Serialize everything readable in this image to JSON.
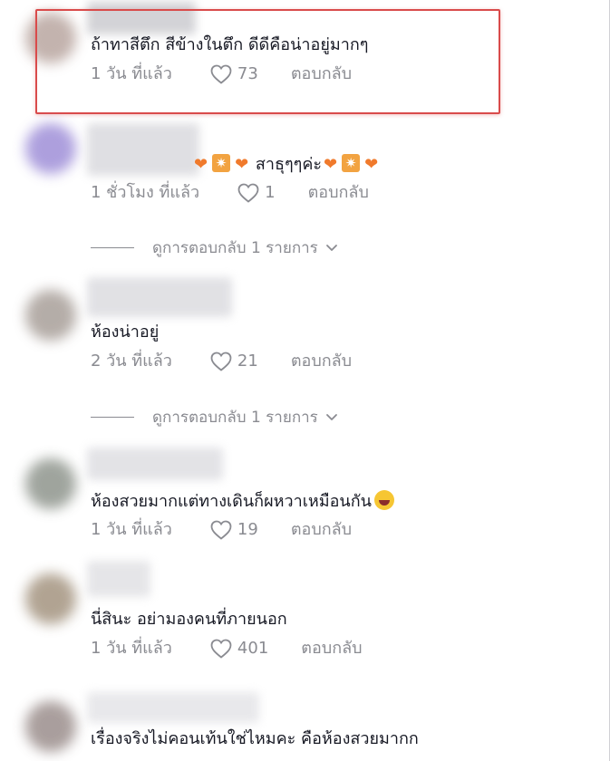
{
  "colors": {
    "text": "#161823",
    "meta": "#8a8b91",
    "highlight_border": "#d94b4b",
    "heart_emoji": "#f07a2c"
  },
  "comments": [
    {
      "text": "ถ้าทาสีตึก สีข้างในตึก ดีดีคือน่าอยู่มากๆ",
      "time": "1 วัน ที่แล้ว",
      "likes": "73",
      "reply": "ตอบกลับ"
    },
    {
      "text": "สาธุๆๆค่ะ",
      "time": "1 ชั่วโมง ที่แล้ว",
      "likes": "1",
      "reply": "ตอบกลับ",
      "view_replies": "ดูการตอบกลับ 1 รายการ"
    },
    {
      "text": "ห้องน่าอยู่",
      "time": "2 วัน ที่แล้ว",
      "likes": "21",
      "reply": "ตอบกลับ",
      "view_replies": "ดูการตอบกลับ 1 รายการ"
    },
    {
      "text": "ห้องสวยมากแต่ทางเดินก็ผหวาเหมือนกัน",
      "time": "1 วัน ที่แล้ว",
      "likes": "19",
      "reply": "ตอบกลับ"
    },
    {
      "text": "นี่สินะ อย่ามองคนที่ภายนอก",
      "time": "1 วัน ที่แล้ว",
      "likes": "401",
      "reply": "ตอบกลับ"
    },
    {
      "text": "เรื่องจริงไม่คอนเท้นใช่ไหมคะ คือห้องสวยมากก"
    }
  ]
}
